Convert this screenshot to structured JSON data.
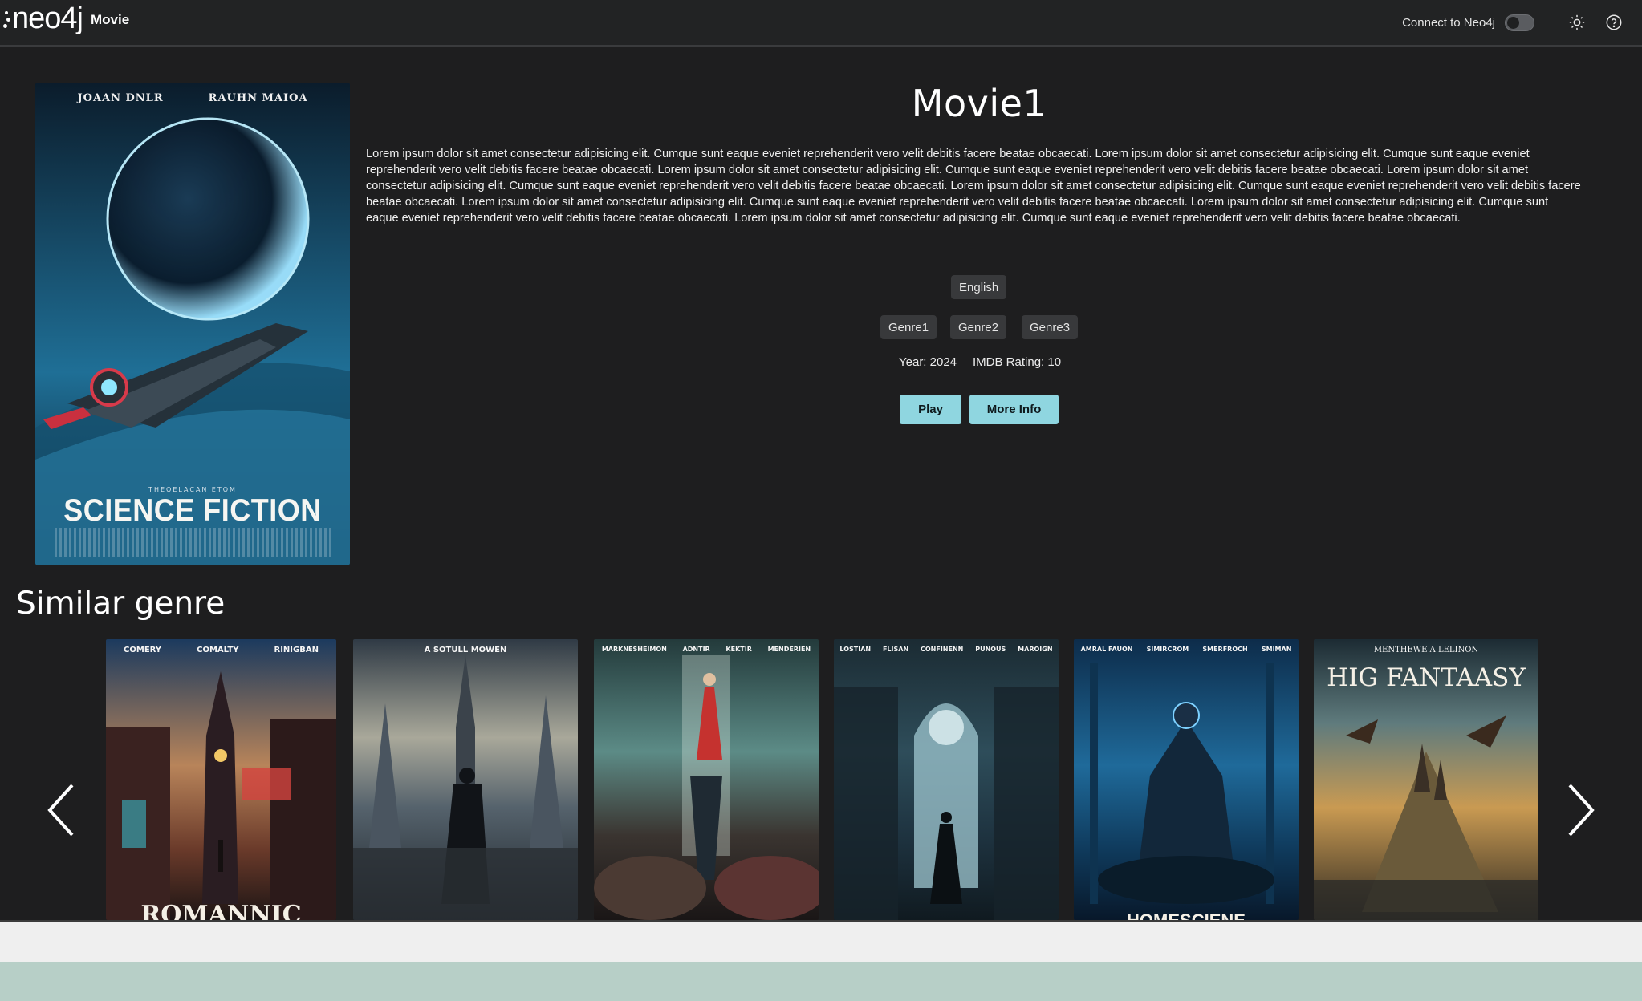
{
  "header": {
    "logo_text": "neo4j",
    "app_name": "Movie",
    "connect_label": "Connect to Neo4j",
    "connect_enabled": false,
    "theme_icon": "sun-icon",
    "help_icon": "help-circle-icon"
  },
  "hero": {
    "poster": {
      "credits": [
        "JOAAN DNLR",
        "RAUHN MAIOA"
      ],
      "tagline": "THEOELACANIETOM",
      "title": "SCIENCE FICTION"
    },
    "title": "Movie1",
    "description": "Lorem ipsum dolor sit amet consectetur adipisicing elit. Cumque sunt eaque eveniet reprehenderit vero velit debitis facere beatae obcaecati. Lorem ipsum dolor sit amet consectetur adipisicing elit. Cumque sunt eaque eveniet reprehenderit vero velit debitis facere beatae obcaecati. Lorem ipsum dolor sit amet consectetur adipisicing elit. Cumque sunt eaque eveniet reprehenderit vero velit debitis facere beatae obcaecati. Lorem ipsum dolor sit amet consectetur adipisicing elit. Cumque sunt eaque eveniet reprehenderit vero velit debitis facere beatae obcaecati. Lorem ipsum dolor sit amet consectetur adipisicing elit. Cumque sunt eaque eveniet reprehenderit vero velit debitis facere beatae obcaecati. Lorem ipsum dolor sit amet consectetur adipisicing elit. Cumque sunt eaque eveniet reprehenderit vero velit debitis facere beatae obcaecati. Lorem ipsum dolor sit amet consectetur adipisicing elit. Cumque sunt eaque eveniet reprehenderit vero velit debitis facere beatae obcaecati. Lorem ipsum dolor sit amet consectetur adipisicing elit. Cumque sunt eaque eveniet reprehenderit vero velit debitis facere beatae obcaecati.",
    "language": "English",
    "genres": [
      "Genre1",
      "Genre2",
      "Genre3"
    ],
    "year": "Year: 2024",
    "rating": "IMDB Rating: 10",
    "play_label": "Play",
    "more_info_label": "More Info"
  },
  "similar": {
    "title": "Similar genre",
    "prev_icon": "chevron-left-icon",
    "next_icon": "chevron-right-icon",
    "items": [
      {
        "credits": [
          "COMERY",
          "COMALTY",
          "RINIGBAN"
        ],
        "title": "ROMANNIC"
      },
      {
        "credits": [
          "A SOTULL MOWEN"
        ],
        "title": ""
      },
      {
        "credits": [
          "MARKNESHEIMON",
          "ADNTIR",
          "KEKTIR",
          "MENDERIEN"
        ],
        "title": ""
      },
      {
        "credits": [
          "LOSTIAN",
          "FLISAN",
          "CONFINENN",
          "PUNOUS",
          "MAROIGN"
        ],
        "title": ""
      },
      {
        "credits": [
          "AMRAL FAUON",
          "SIMIRCROM",
          "SMERFROCH",
          "SMIMAN"
        ],
        "title": "HOMESCIENE"
      },
      {
        "credits": [
          "MENTHEWE A LELINON"
        ],
        "title": "HIG FANTAASY"
      }
    ]
  },
  "colors": {
    "background": "#1e1e1f",
    "header": "#222324",
    "accent_button": "#8fd6e0",
    "badge": "#38393b"
  }
}
